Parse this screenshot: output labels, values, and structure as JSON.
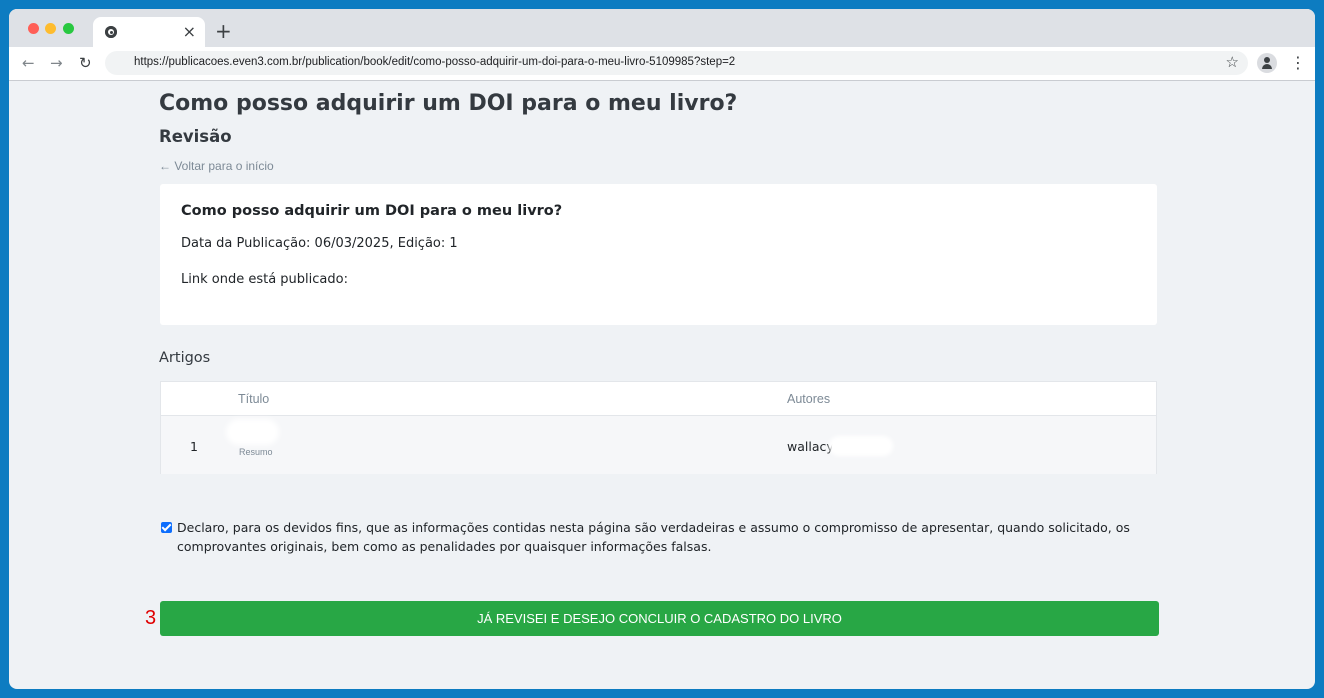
{
  "browser": {
    "tab_close": "×",
    "new_tab": "+",
    "url": "https://publicacoes.even3.com.br/publication/book/edit/como-posso-adquirir-um-doi-para-o-meu-livro-5109985?step=2",
    "back_glyph": "←",
    "forward_glyph": "→",
    "reload_glyph": "↻",
    "star_glyph": "☆",
    "menu_glyph": "⋮",
    "icons": [
      "chrome-favicon-icon",
      "back-arrow-icon",
      "forward-arrow-icon",
      "reload-icon",
      "bookmark-star-icon",
      "profile-icon",
      "kebab-menu-icon"
    ]
  },
  "page": {
    "title": "Como posso adquirir um DOI para o meu livro?",
    "section": "Revisão",
    "back_link": "← Voltar para o início"
  },
  "summary_card": {
    "title": "Como posso adquirir um DOI para o meu livro?",
    "date_line": "Data da Publicação: 06/03/2025, Edição: 1",
    "link_line": "Link onde está publicado:"
  },
  "articles": {
    "heading": "Artigos",
    "columns": [
      "Título",
      "Autores"
    ],
    "rows": [
      {
        "number": "1",
        "resumo": "Resumo",
        "author": "wallacy"
      }
    ]
  },
  "declaration": {
    "checked": true,
    "text": "Declaro, para os devidos fins, que as informações contidas nesta página são verdadeiras e assumo o compromisso de apresentar, quando solicitado, os comprovantes originais, bem como as penalidades por quaisquer informações falsas."
  },
  "submit": {
    "step_marker": "3",
    "label": "JÁ REVISEI E DESEJO CONCLUIR O CADASTRO DO LIVRO",
    "color": "#28a745"
  },
  "colors": {
    "frame": "#0d7cc1",
    "page_bg": "#eff2f5",
    "checkbox": "#0d6efd",
    "marker": "#e00000"
  }
}
